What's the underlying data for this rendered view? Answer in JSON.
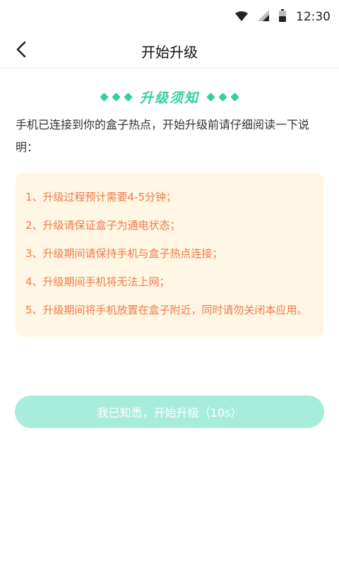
{
  "status_bar": {
    "time": "12:30",
    "icons": [
      "wifi-icon",
      "signal-icon",
      "battery-icon"
    ]
  },
  "header": {
    "back_icon": "chevron-left-icon",
    "title": "开始升级"
  },
  "notice": {
    "title": "升级须知",
    "intro": "手机已连接到你的盒子热点，开始升级前请仔细阅读一下说明：",
    "items": [
      "1、升级过程预计需要4-5分钟；",
      "2、升级请保证盒子为通电状态；",
      "3、升级期间请保持手机与盒子热点连接；",
      "4、升级期间手机将无法上网；",
      "5、升级期间将手机放置在盒子附近，同时请勿关闭本应用。"
    ]
  },
  "cta": {
    "label": "我已知悉，开始升级（10s）"
  },
  "colors": {
    "accent": "#36cfa2",
    "button_bg": "#a8ecdc",
    "notice_bg": "#fff6e4",
    "notice_text": "#f07a4b"
  }
}
